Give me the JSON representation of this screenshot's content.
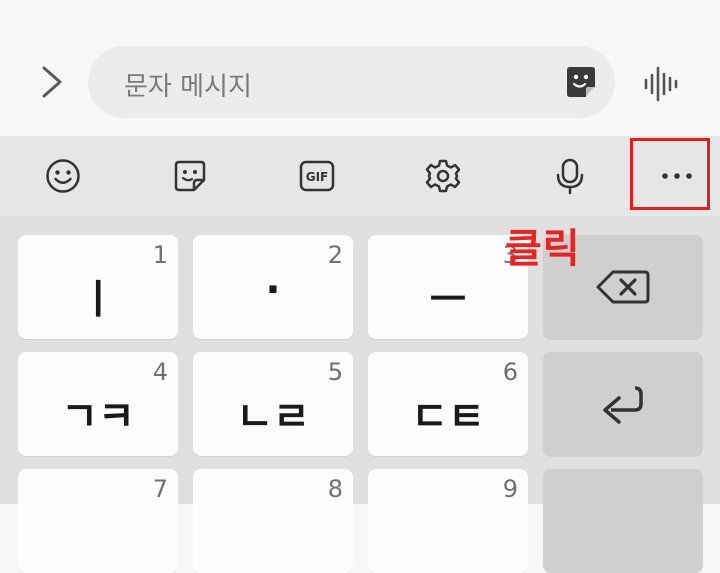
{
  "compose": {
    "placeholder": "문자 메시지"
  },
  "annotation": {
    "click_label": "클릭",
    "color": "#e0201f"
  },
  "toolbar": {
    "icons": [
      "emoji-icon",
      "sticker-icon",
      "gif-icon",
      "settings-icon",
      "microphone-icon",
      "more-options-icon"
    ],
    "gif_label": "GIF"
  },
  "keys": {
    "k1": {
      "num": "1",
      "char": "ㅣ"
    },
    "k2": {
      "num": "2",
      "char": "·"
    },
    "k3": {
      "num": "3",
      "char": "ㅡ"
    },
    "k4": {
      "num": "4",
      "char": "ㄱㅋ"
    },
    "k5": {
      "num": "5",
      "char": "ㄴㄹ"
    },
    "k6": {
      "num": "6",
      "char": "ㄷㅌ"
    },
    "k7": {
      "num": "7"
    },
    "k8": {
      "num": "8"
    },
    "k9": {
      "num": "9"
    }
  },
  "colors": {
    "keyboard_bg": "#e0e0e0",
    "key_bg": "#fdfdfd",
    "toolbar_bg": "#e6e6e6"
  }
}
